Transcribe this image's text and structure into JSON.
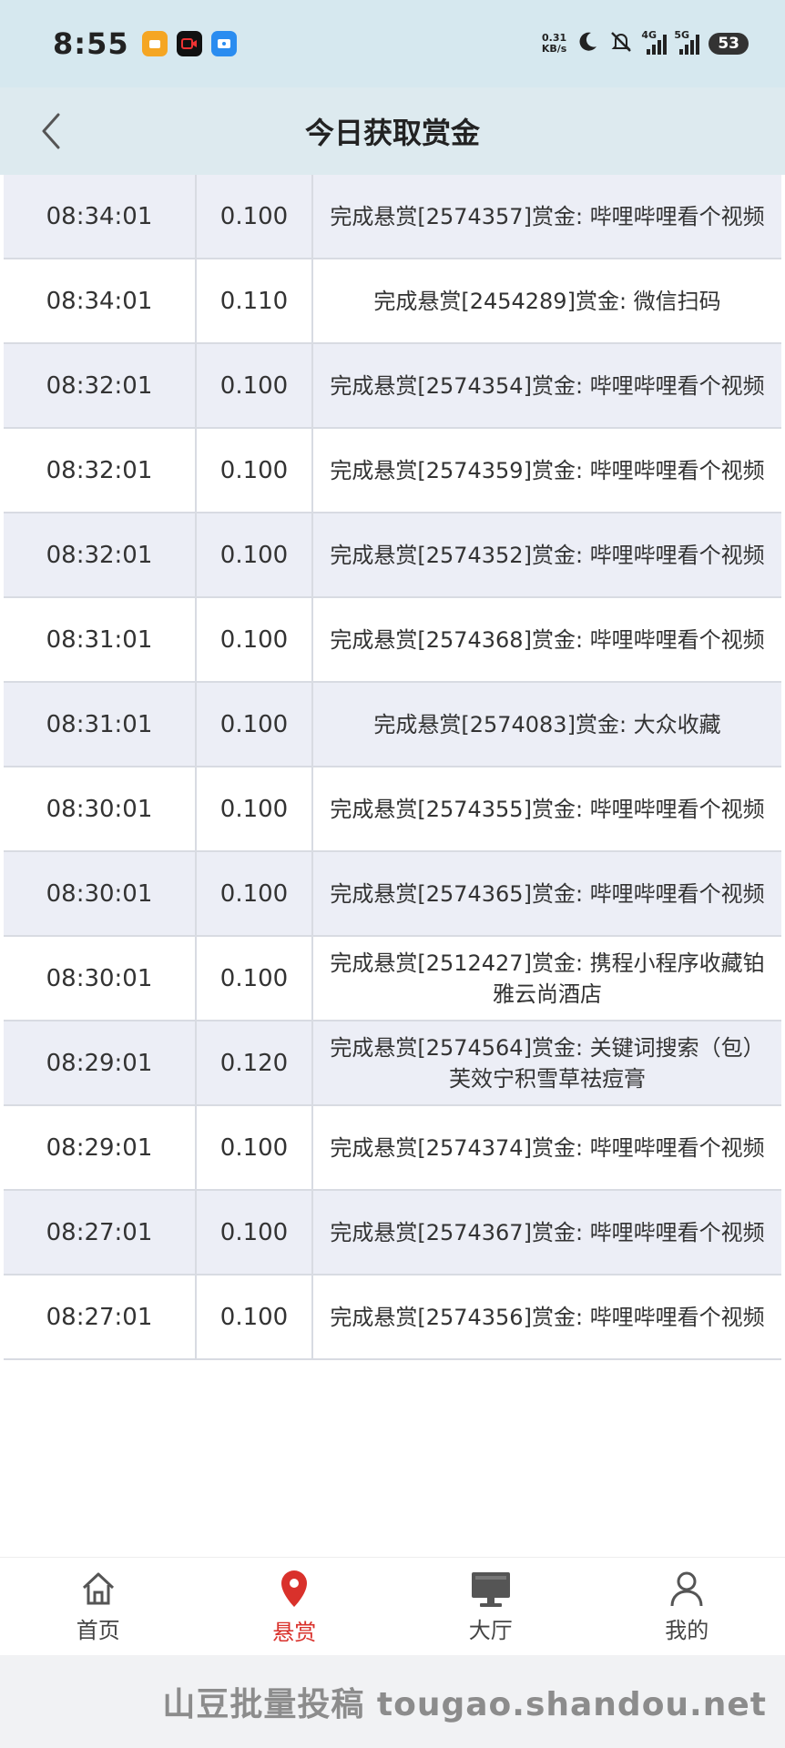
{
  "status_bar": {
    "time": "8:55",
    "net_speed_value": "0.31",
    "net_speed_unit": "KB/s",
    "signal_1_label": "4G",
    "signal_2_label": "5G",
    "battery": "53"
  },
  "header": {
    "title": "今日获取赏金"
  },
  "rows": [
    {
      "time": "08:34:01",
      "amount": "0.100",
      "desc": "完成悬赏[2574357]赏金: 哔哩哔哩看个视频"
    },
    {
      "time": "08:34:01",
      "amount": "0.110",
      "desc": "完成悬赏[2454289]赏金: 微信扫码"
    },
    {
      "time": "08:32:01",
      "amount": "0.100",
      "desc": "完成悬赏[2574354]赏金: 哔哩哔哩看个视频"
    },
    {
      "time": "08:32:01",
      "amount": "0.100",
      "desc": "完成悬赏[2574359]赏金: 哔哩哔哩看个视频"
    },
    {
      "time": "08:32:01",
      "amount": "0.100",
      "desc": "完成悬赏[2574352]赏金: 哔哩哔哩看个视频"
    },
    {
      "time": "08:31:01",
      "amount": "0.100",
      "desc": "完成悬赏[2574368]赏金: 哔哩哔哩看个视频"
    },
    {
      "time": "08:31:01",
      "amount": "0.100",
      "desc": "完成悬赏[2574083]赏金: 大众收藏"
    },
    {
      "time": "08:30:01",
      "amount": "0.100",
      "desc": "完成悬赏[2574355]赏金: 哔哩哔哩看个视频"
    },
    {
      "time": "08:30:01",
      "amount": "0.100",
      "desc": "完成悬赏[2574365]赏金: 哔哩哔哩看个视频"
    },
    {
      "time": "08:30:01",
      "amount": "0.100",
      "desc": "完成悬赏[2512427]赏金: 携程小程序收藏铂雅云尚酒店"
    },
    {
      "time": "08:29:01",
      "amount": "0.120",
      "desc": "完成悬赏[2574564]赏金: 关键词搜索（包）芙效宁积雪草祛痘膏"
    },
    {
      "time": "08:29:01",
      "amount": "0.100",
      "desc": "完成悬赏[2574374]赏金: 哔哩哔哩看个视频"
    },
    {
      "time": "08:27:01",
      "amount": "0.100",
      "desc": "完成悬赏[2574367]赏金: 哔哩哔哩看个视频"
    },
    {
      "time": "08:27:01",
      "amount": "0.100",
      "desc": "完成悬赏[2574356]赏金: 哔哩哔哩看个视频"
    }
  ],
  "tabs": [
    {
      "label": "首页",
      "icon": "home-icon",
      "active": false
    },
    {
      "label": "悬赏",
      "icon": "location-pin-icon",
      "active": true
    },
    {
      "label": "大厅",
      "icon": "monitor-icon",
      "active": false
    },
    {
      "label": "我的",
      "icon": "user-icon",
      "active": false
    }
  ],
  "colors": {
    "active_tab": "#d9312b",
    "header_bg": "#ddeaef",
    "row_alt_bg": "#eceef6"
  },
  "watermark": "山豆批量投稿 tougao.shandou.net"
}
